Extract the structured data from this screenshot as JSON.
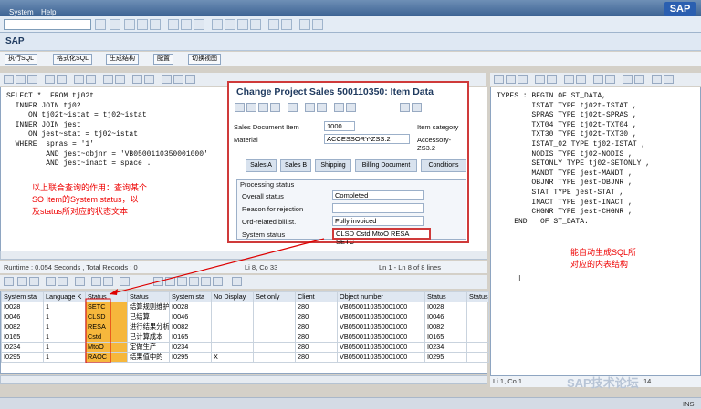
{
  "menu": {
    "system": "System",
    "help": "Help",
    "brand": "SAP"
  },
  "title": "SAP",
  "app_buttons": [
    "执行SQL",
    "格式化SQL",
    "生成结构",
    "配置",
    "切换视图"
  ],
  "editor": {
    "code": "SELECT *  FROM tj02t\n  INNER JOIN tj02\n     ON tj02t~istat = tj02~istat\n  INNER JOIN jest\n     ON jest~stat = tj02~istat\n  WHERE  spras = '1'\n         AND jest~objnr = 'VB0500110350001000'\n         AND jest~inact = space .",
    "note": "以上联合查询的作用：查询某个\nSO Item的System status，以\n及status所对应的状态文本"
  },
  "status_row": {
    "runtime": "Runtime : 0.054  Seconds , Total Records : 0",
    "position": "Li 8, Co 33",
    "lines": "Ln 1 - Ln 8 of 8 lines"
  },
  "popup": {
    "title": "Change Project Sales 500110350: Item Data",
    "sales_doc_label": "Sales Document Item",
    "sales_doc_value": "1000",
    "item_category_label": "Item category",
    "material_label": "Material",
    "material_value": "ACCESSORY-ZSS.2",
    "material_text": "Accessory-ZS3.2",
    "tabs": [
      "Sales A",
      "Sales B",
      "Shipping",
      "Billing Document",
      "Conditions"
    ],
    "section": "Processing status",
    "rows": [
      {
        "label": "Overall status",
        "value": "Completed"
      },
      {
        "label": "Reason for rejection",
        "value": ""
      },
      {
        "label": "Ord-related bill.st.",
        "value": "Fully invoiced"
      },
      {
        "label": "System status",
        "value": "CLSD Cstd MtoO RESA SETC"
      }
    ]
  },
  "right": {
    "code": "TYPES : BEGIN OF ST_DATA,\n        ISTAT TYPE tj02t-ISTAT ,\n        SPRAS TYPE tj02t-SPRAS ,\n        TXT04 TYPE tj02t-TXT04 ,\n        TXT30 TYPE tj02t-TXT30 ,\n        ISTAT_02 TYPE tj02-ISTAT ,\n        NODIS TYPE tj02-NODIS ,\n        SETONLY TYPE tj02-SETONLY ,\n        MANDT TYPE jest-MANDT ,\n        OBJNR TYPE jest-OBJNR ,\n        STAT TYPE jest-STAT ,\n        INACT TYPE jest-INACT ,\n        CHGNR TYPE jest-CHGNR ,\n    END   OF ST_DATA.",
    "note": "能自动生成SQL所\n对应的内表结构",
    "footer": "Li 1, Co 1",
    "footer_right": "14",
    "watermark": "SAP技术论坛"
  },
  "grid": {
    "headers": [
      "System sta",
      "Language K",
      "Status",
      "Status",
      "System sta",
      "No Display",
      "Set only",
      "Client",
      "Object number",
      "Status",
      "Status"
    ],
    "rows": [
      [
        "I0028",
        "1",
        "SETC",
        "结算规则维护",
        "I0028",
        "",
        "",
        "280",
        "VB0500110350001000",
        "I0028",
        ""
      ],
      [
        "I0046",
        "1",
        "CLSD",
        "已结算",
        "I0046",
        "",
        "",
        "280",
        "VB0500110350001000",
        "I0046",
        ""
      ],
      [
        "I0082",
        "1",
        "RESA",
        "进行结果分析",
        "I0082",
        "",
        "",
        "280",
        "VB0500110350001000",
        "I0082",
        ""
      ],
      [
        "I0165",
        "1",
        "Cstd",
        "已计算成本",
        "I0165",
        "",
        "",
        "280",
        "VB0500110350001000",
        "I0165",
        ""
      ],
      [
        "I0234",
        "1",
        "MtoO",
        "定做生产",
        "I0234",
        "",
        "",
        "280",
        "VB0500110350001000",
        "I0234",
        ""
      ],
      [
        "I0295",
        "1",
        "RAOC",
        "结果值中的",
        "I0295",
        "X",
        "",
        "280",
        "VB0500110350001000",
        "I0295",
        ""
      ]
    ]
  },
  "statusbar": {
    "ins": "INS"
  }
}
